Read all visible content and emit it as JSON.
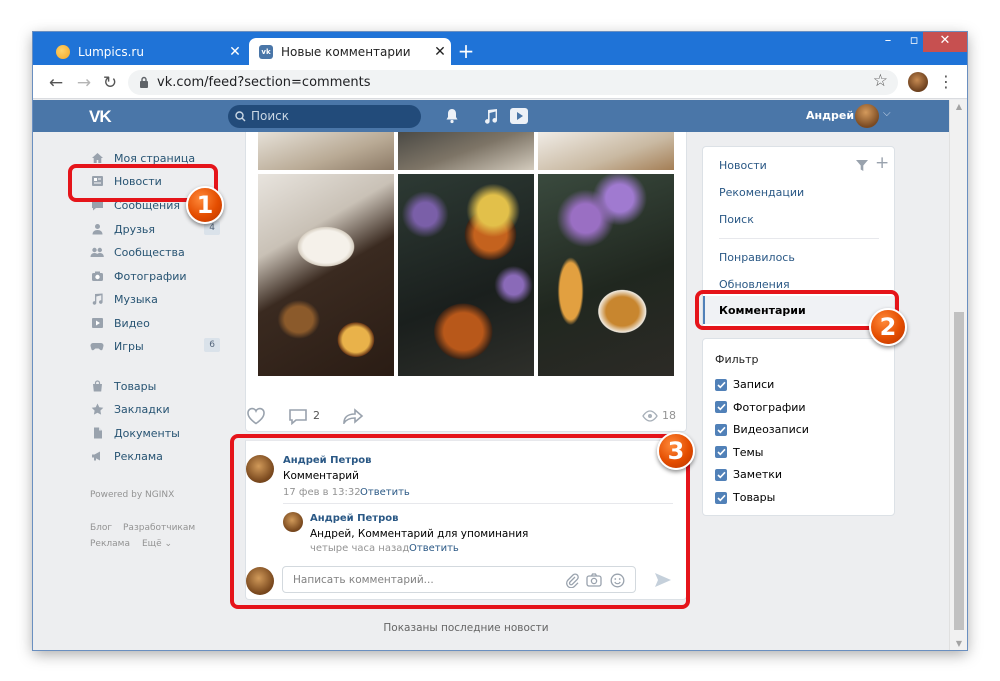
{
  "browser": {
    "tabs": [
      {
        "title": "Lumpics.ru",
        "favicon_color": "#f5a623"
      },
      {
        "title": "Новые комментарии",
        "favicon_color": "#4a76a8"
      }
    ],
    "url": "vk.com/feed?section=comments"
  },
  "header": {
    "logo": "VK",
    "search_placeholder": "Поиск",
    "user_name": "Андрей"
  },
  "left_nav": {
    "items": [
      {
        "label": "Моя страница",
        "icon": "home-icon"
      },
      {
        "label": "Новости",
        "icon": "news-icon"
      },
      {
        "label": "Сообщения",
        "icon": "messages-icon"
      },
      {
        "label": "Друзья",
        "icon": "friends-icon",
        "count": "4"
      },
      {
        "label": "Сообщества",
        "icon": "groups-icon"
      },
      {
        "label": "Фотографии",
        "icon": "camera-icon"
      },
      {
        "label": "Музыка",
        "icon": "music-icon"
      },
      {
        "label": "Видео",
        "icon": "video-icon"
      },
      {
        "label": "Игры",
        "icon": "games-icon",
        "count": "6"
      },
      {
        "label": "Товары",
        "icon": "bag-icon"
      },
      {
        "label": "Закладки",
        "icon": "star-icon"
      },
      {
        "label": "Документы",
        "icon": "document-icon"
      },
      {
        "label": "Реклама",
        "icon": "megaphone-icon"
      }
    ],
    "powered_by": "Powered by NGINX",
    "footer_links": [
      "Блог",
      "Разработчикам",
      "Реклама",
      "Ещё ⌄"
    ]
  },
  "post": {
    "comments_count": "2",
    "views": "18"
  },
  "comments": [
    {
      "author": "Андрей Петров",
      "text": "Комментарий",
      "date": "17 фев в 13:32",
      "reply_label": "Ответить"
    },
    {
      "author": "Андрей Петров",
      "text": "Андрей, Комментарий для упоминания",
      "date": "четыре часа назад",
      "reply_label": "Ответить"
    }
  ],
  "comment_input_placeholder": "Написать комментарий...",
  "feed_footer": "Показаны последние новости",
  "right_menu": {
    "items": [
      "Новости",
      "Рекомендации",
      "Поиск",
      "Понравилось",
      "Обновления",
      "Комментарии"
    ],
    "filter_title": "Фильтр",
    "filters": [
      "Записи",
      "Фотографии",
      "Видеозаписи",
      "Темы",
      "Заметки",
      "Товары"
    ]
  },
  "annotations": [
    "1",
    "2",
    "3"
  ],
  "colors": {
    "vk_blue": "#4a76a8",
    "link": "#2a5885",
    "annotation_red": "#e5141a",
    "badge_orange": "#e44d00"
  }
}
